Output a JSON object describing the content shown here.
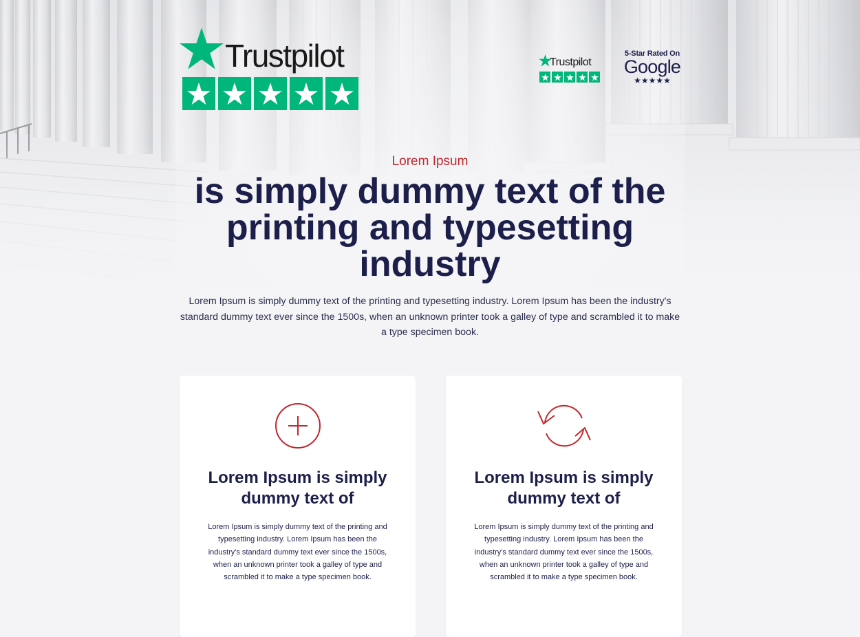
{
  "badges": {
    "trustpilot_main": {
      "wordmark": "Trustpilot",
      "stars": 5,
      "icon": "trustpilot-star-icon"
    },
    "trustpilot_small": {
      "wordmark": "Trustpilot",
      "stars": 5
    },
    "google": {
      "top": "5-Star Rated On",
      "wordmark": "Google",
      "stars": "★★★★★"
    }
  },
  "hero": {
    "eyebrow": "Lorem Ipsum",
    "headline": "is simply dummy text of the printing and typesetting industry",
    "lead": "Lorem Ipsum is simply dummy text of the printing and typesetting industry. Lorem Ipsum has been the industry's standard dummy text ever since the 1500s, when an unknown printer took a galley of type and scrambled it to make a type specimen book."
  },
  "cards": [
    {
      "icon": "plus-circle-icon",
      "title": "Lorem Ipsum is simply dummy text of",
      "body": "Lorem Ipsum is simply dummy text of the printing and typesetting industry. Lorem Ipsum has been the industry's standard dummy text ever since the 1500s, when an unknown printer took a galley of type and scrambled it to make a type specimen book."
    },
    {
      "icon": "refresh-arrows-icon",
      "title": "Lorem Ipsum is simply dummy text of",
      "body": "Lorem Ipsum is simply dummy text of the printing and typesetting industry. Lorem Ipsum has been the industry's standard dummy text ever since the 1500s, when an unknown printer took a galley of type and scrambled it to make a type specimen book."
    }
  ],
  "colors": {
    "accent_red": "#c1272d",
    "navy": "#1c1f4a",
    "trustpilot_green": "#00b67a",
    "background": "#f4f4f6"
  }
}
